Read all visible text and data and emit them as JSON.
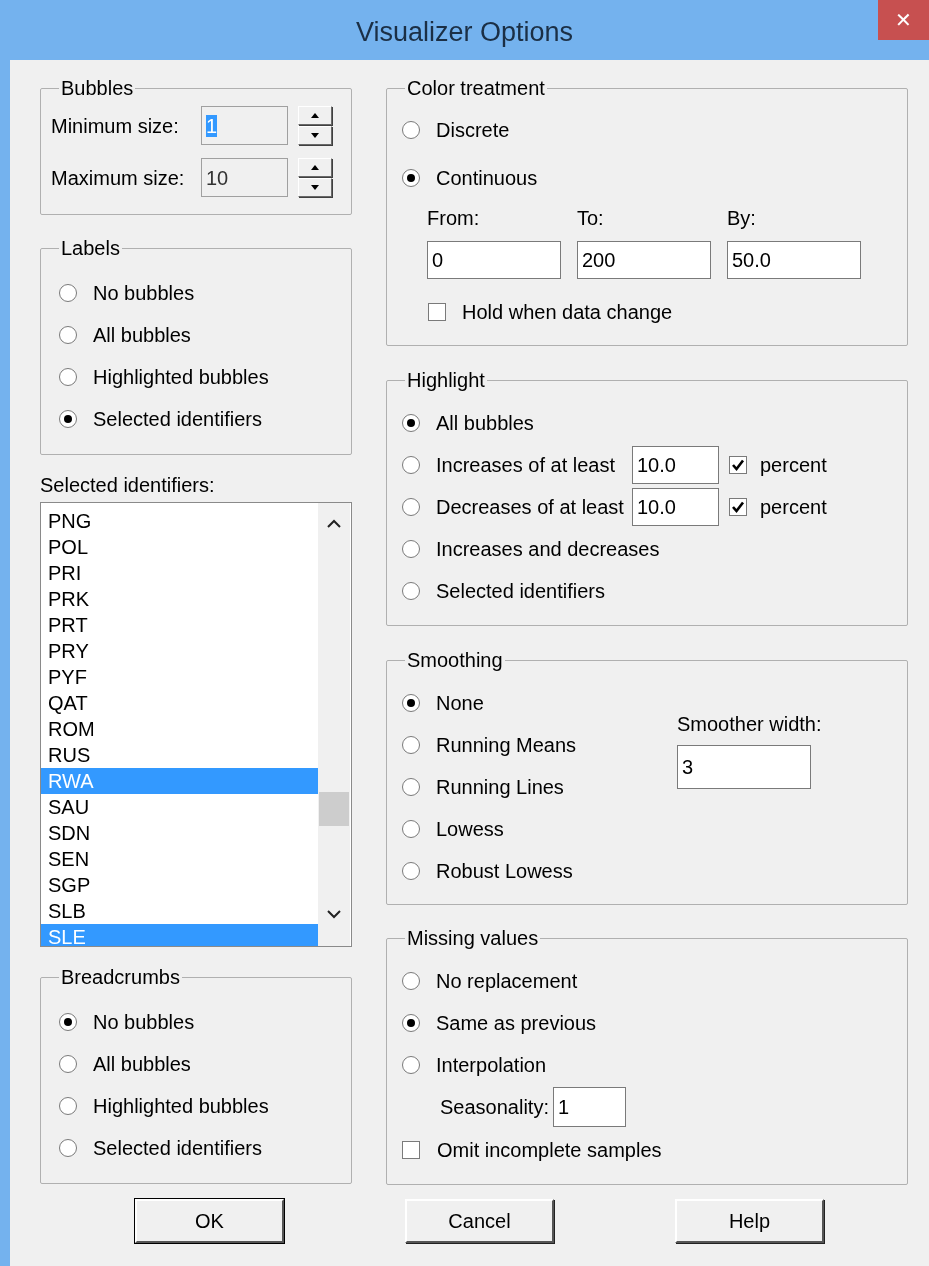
{
  "window": {
    "title": "Visualizer Options",
    "close": "✕"
  },
  "bubbles": {
    "title": "Bubbles",
    "fields": [
      {
        "label": "Minimum size:",
        "value": "1",
        "selected": true
      },
      {
        "label": "Maximum size:",
        "value": "10",
        "selected": false
      }
    ]
  },
  "labels": {
    "title": "Labels",
    "options": [
      {
        "label": "No bubbles",
        "selected": false
      },
      {
        "label": "All bubbles",
        "selected": false
      },
      {
        "label": "Highlighted bubbles",
        "selected": false
      },
      {
        "label": "Selected identifiers",
        "selected": true
      }
    ]
  },
  "selected_identifiers": {
    "label": "Selected identifiers:",
    "items": [
      {
        "text": "PNG",
        "selected": false
      },
      {
        "text": "POL",
        "selected": false
      },
      {
        "text": "PRI",
        "selected": false
      },
      {
        "text": "PRK",
        "selected": false
      },
      {
        "text": "PRT",
        "selected": false
      },
      {
        "text": "PRY",
        "selected": false
      },
      {
        "text": "PYF",
        "selected": false
      },
      {
        "text": "QAT",
        "selected": false
      },
      {
        "text": "ROM",
        "selected": false
      },
      {
        "text": "RUS",
        "selected": false
      },
      {
        "text": "RWA",
        "selected": true
      },
      {
        "text": "SAU",
        "selected": false
      },
      {
        "text": "SDN",
        "selected": false
      },
      {
        "text": "SEN",
        "selected": false
      },
      {
        "text": "SGP",
        "selected": false
      },
      {
        "text": "SLB",
        "selected": false
      },
      {
        "text": "SLE",
        "selected": true
      }
    ]
  },
  "breadcrumbs": {
    "title": "Breadcrumbs",
    "options": [
      {
        "label": "No bubbles",
        "selected": true
      },
      {
        "label": "All bubbles",
        "selected": false
      },
      {
        "label": "Highlighted bubbles",
        "selected": false
      },
      {
        "label": "Selected identifiers",
        "selected": false
      }
    ]
  },
  "color_treatment": {
    "title": "Color treatment",
    "options": [
      {
        "label": "Discrete",
        "selected": false
      },
      {
        "label": "Continuous",
        "selected": true
      }
    ],
    "fields": [
      {
        "label": "From:",
        "value": "0"
      },
      {
        "label": "To:",
        "value": "200"
      },
      {
        "label": "By:",
        "value": "50.0"
      }
    ],
    "hold": {
      "label": "Hold when data change",
      "checked": false
    }
  },
  "highlight": {
    "title": "Highlight",
    "options": [
      {
        "label": "All bubbles",
        "selected": true
      },
      {
        "label": "Increases of at least",
        "selected": false,
        "value": "10.0",
        "percent": {
          "label": "percent",
          "checked": true
        }
      },
      {
        "label": "Decreases of at least",
        "selected": false,
        "value": "10.0",
        "percent": {
          "label": "percent",
          "checked": true
        }
      },
      {
        "label": "Increases and decreases",
        "selected": false
      },
      {
        "label": "Selected identifiers",
        "selected": false
      }
    ]
  },
  "smoothing": {
    "title": "Smoothing",
    "options": [
      {
        "label": "None",
        "selected": true
      },
      {
        "label": "Running Means",
        "selected": false
      },
      {
        "label": "Running Lines",
        "selected": false
      },
      {
        "label": "Lowess",
        "selected": false
      },
      {
        "label": "Robust Lowess",
        "selected": false
      }
    ],
    "width": {
      "label": "Smoother width:",
      "value": "3"
    }
  },
  "missing_values": {
    "title": "Missing values",
    "options": [
      {
        "label": "No replacement",
        "selected": false
      },
      {
        "label": "Same as previous",
        "selected": true
      },
      {
        "label": "Interpolation",
        "selected": false
      }
    ],
    "seasonality": {
      "label": "Seasonality:",
      "value": "1"
    },
    "omit": {
      "label": "Omit incomplete samples",
      "checked": false
    }
  },
  "buttons": [
    "OK",
    "Cancel",
    "Help"
  ]
}
